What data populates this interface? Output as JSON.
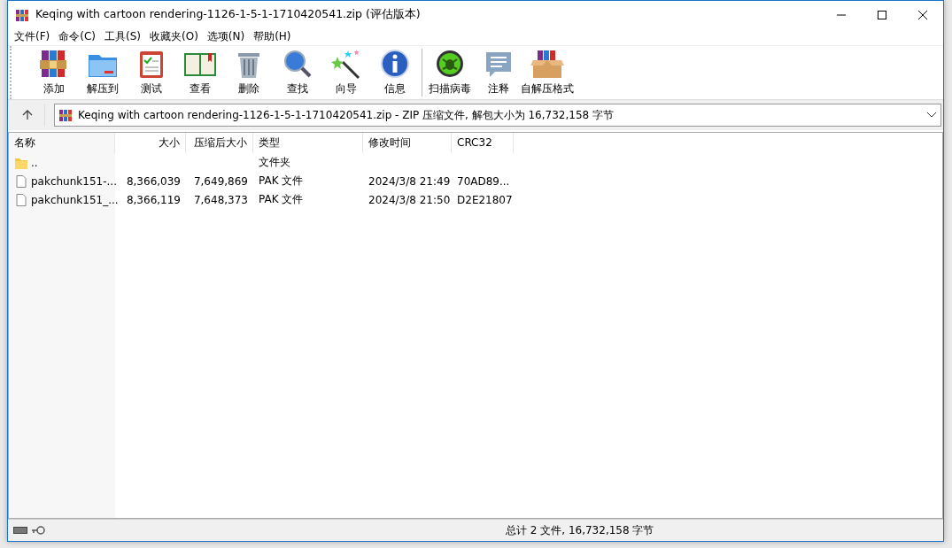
{
  "window": {
    "title": "Keqing with cartoon rendering-1126-1-5-1-1710420541.zip (评估版本)"
  },
  "menu": [
    "文件(F)",
    "命令(C)",
    "工具(S)",
    "收藏夹(O)",
    "选项(N)",
    "帮助(H)"
  ],
  "toolbar": {
    "groups": [
      [
        {
          "kind": "add",
          "label": "添加"
        },
        {
          "kind": "extract",
          "label": "解压到"
        },
        {
          "kind": "test",
          "label": "测试"
        },
        {
          "kind": "view",
          "label": "查看"
        },
        {
          "kind": "delete",
          "label": "删除"
        },
        {
          "kind": "find",
          "label": "查找"
        },
        {
          "kind": "wizard",
          "label": "向导"
        },
        {
          "kind": "info",
          "label": "信息"
        }
      ],
      [
        {
          "kind": "scan",
          "label": "扫描病毒"
        },
        {
          "kind": "comment",
          "label": "注释"
        },
        {
          "kind": "sfx",
          "label": "自解压格式"
        }
      ]
    ]
  },
  "address": {
    "path": "Keqing with cartoon rendering-1126-1-5-1-1710420541.zip - ZIP 压缩文件, 解包大小为 16,732,158 字节"
  },
  "table": {
    "columns": [
      {
        "label": "名称"
      },
      {
        "label": "大小"
      },
      {
        "label": "压缩后大小"
      },
      {
        "label": "类型"
      },
      {
        "label": "修改时间"
      },
      {
        "label": "CRC32"
      }
    ],
    "rows": [
      {
        "kind": "folder",
        "cells": [
          "..",
          "",
          "",
          "文件夹",
          "",
          ""
        ]
      },
      {
        "kind": "file",
        "cells": [
          "pakchunk151-...",
          "8,366,039",
          "7,649,869",
          "PAK 文件",
          "2024/3/8 21:49",
          "70AD89..."
        ]
      },
      {
        "kind": "file",
        "cells": [
          "pakchunk151_...",
          "8,366,119",
          "7,648,373",
          "PAK 文件",
          "2024/3/8 21:50",
          "D2E21807"
        ]
      }
    ]
  },
  "status_bar": {
    "text": "总计 2 文件, 16,732,158 字节"
  }
}
